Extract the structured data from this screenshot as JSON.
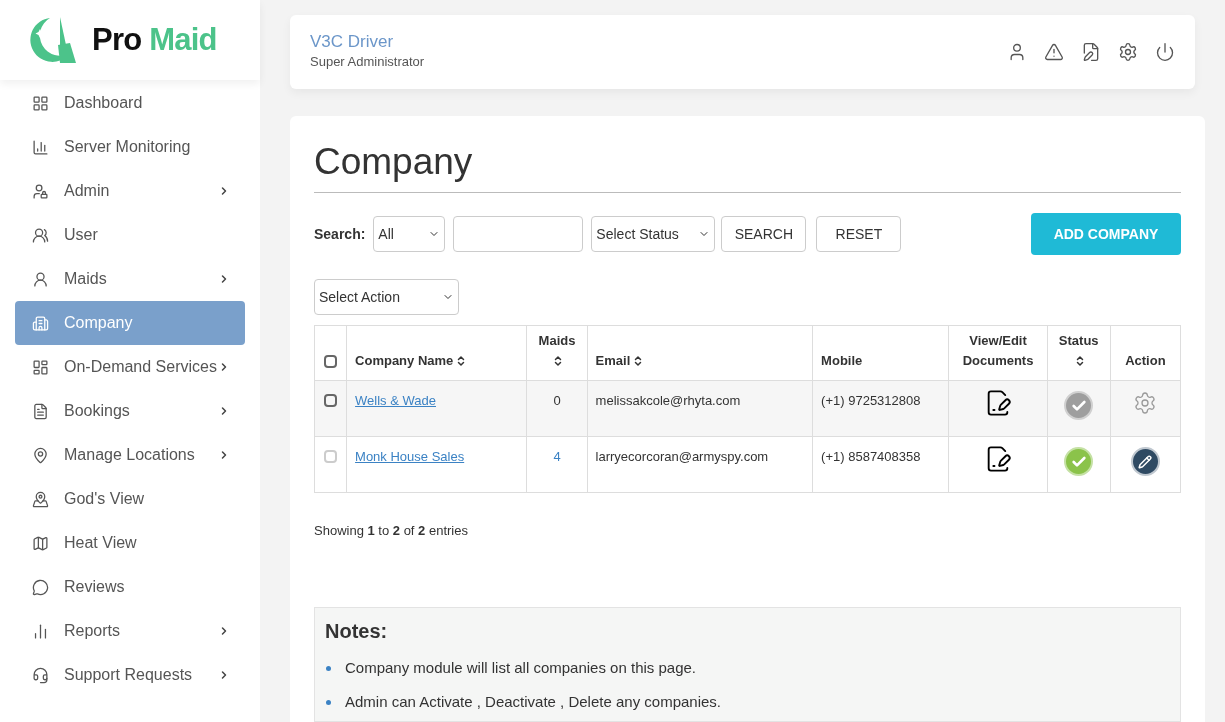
{
  "brand": {
    "name_dark": "Pro",
    "name_accent": "Maid"
  },
  "sidebar": {
    "items": [
      {
        "label": "Dashboard",
        "selected": false,
        "has_submenu": false
      },
      {
        "label": "Server Monitoring",
        "selected": false,
        "has_submenu": false
      },
      {
        "label": "Admin",
        "selected": false,
        "has_submenu": true
      },
      {
        "label": "User",
        "selected": false,
        "has_submenu": false
      },
      {
        "label": "Maids",
        "selected": false,
        "has_submenu": true
      },
      {
        "label": "Company",
        "selected": true,
        "has_submenu": false
      },
      {
        "label": "On-Demand Services",
        "selected": false,
        "has_submenu": true
      },
      {
        "label": "Bookings",
        "selected": false,
        "has_submenu": true
      },
      {
        "label": "Manage Locations",
        "selected": false,
        "has_submenu": true
      },
      {
        "label": "God's View",
        "selected": false,
        "has_submenu": false
      },
      {
        "label": "Heat View",
        "selected": false,
        "has_submenu": false
      },
      {
        "label": "Reviews",
        "selected": false,
        "has_submenu": false
      },
      {
        "label": "Reports",
        "selected": false,
        "has_submenu": true
      },
      {
        "label": "Support Requests",
        "selected": false,
        "has_submenu": true
      }
    ]
  },
  "header": {
    "user_name": "V3C Driver",
    "user_role": "Super Administrator"
  },
  "page": {
    "title": "Company",
    "search": {
      "label": "Search:",
      "scope_value": "All",
      "status_value": "Select Status",
      "search_button": "SEARCH",
      "reset_button": "RESET",
      "add_button": "ADD COMPANY"
    },
    "action_select": "Select Action",
    "table": {
      "select_all_checked": false,
      "columns": [
        {
          "label": "Company Name",
          "sortable": true
        },
        {
          "label": "Maids",
          "sortable": true
        },
        {
          "label": "Email",
          "sortable": true
        },
        {
          "label": "Mobile",
          "sortable": false
        },
        {
          "label": "View/Edit Documents",
          "sortable": false
        },
        {
          "label": "Status",
          "sortable": true
        },
        {
          "label": "Action",
          "sortable": false
        }
      ],
      "rows": [
        {
          "name": "Wells & Wade",
          "maids": "0",
          "maids_linked": false,
          "email": "melissakcole@rhyta.com",
          "mobile": "(+1) 9725312808",
          "active": false,
          "action": {
            "kind": "settings"
          },
          "highlighted": true,
          "disabled": false
        },
        {
          "name": "Monk House Sales",
          "maids": "4",
          "maids_linked": true,
          "email": "larryecorcoran@armyspy.com",
          "mobile": "(+1) 8587408358",
          "active": true,
          "action": {
            "kind": "edit"
          },
          "highlighted": false,
          "disabled": true
        }
      ]
    },
    "summary": "Showing **1** to **2** of **2** entries",
    "notes": {
      "title": "Notes:",
      "items": [
        "Company module will list all companies on this page.",
        "Admin can Activate , Deactivate , Delete any companies."
      ]
    }
  }
}
